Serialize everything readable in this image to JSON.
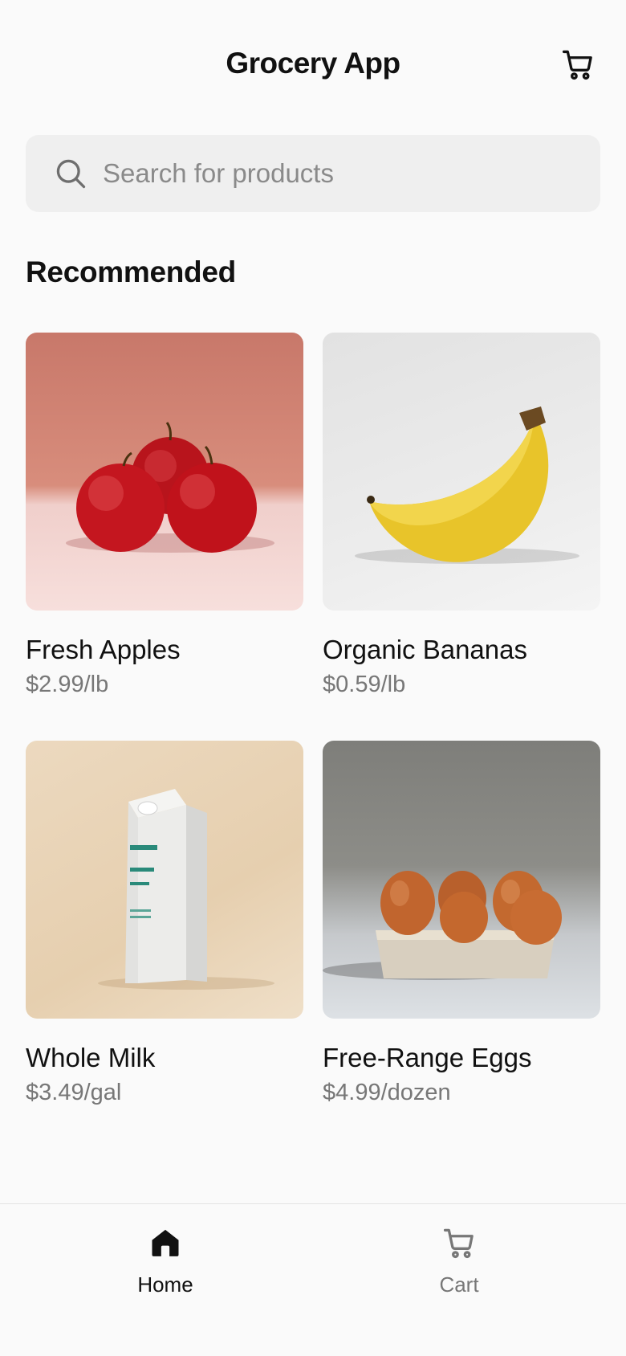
{
  "header": {
    "title": "Grocery App",
    "cart_icon": "cart-icon"
  },
  "search": {
    "placeholder": "Search for products",
    "icon": "search-icon"
  },
  "recommended": {
    "title": "Recommended",
    "products": [
      {
        "name": "Fresh Apples",
        "price": "$2.99/lb",
        "image": "apples"
      },
      {
        "name": "Organic Bananas",
        "price": "$0.59/lb",
        "image": "bananas"
      },
      {
        "name": "Whole Milk",
        "price": "$3.49/gal",
        "image": "milk-carton"
      },
      {
        "name": "Free-Range Eggs",
        "price": "$4.99/dozen",
        "image": "eggs"
      }
    ]
  },
  "bottom_nav": {
    "items": [
      {
        "label": "Home",
        "icon": "home-icon",
        "active": true
      },
      {
        "label": "Cart",
        "icon": "cart-icon",
        "active": false
      }
    ]
  },
  "colors": {
    "background": "#fafafa",
    "search_bg": "#efefef",
    "text_primary": "#111111",
    "text_secondary": "#777777"
  }
}
